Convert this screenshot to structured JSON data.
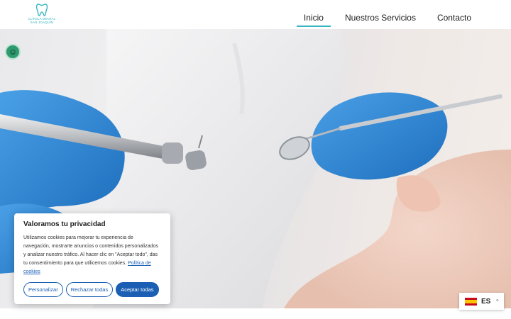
{
  "header": {
    "logo": {
      "line1": "CLÍNICA DENTAL",
      "line2": "SAN JOAQUÍN"
    },
    "nav": [
      {
        "label": "Inicio",
        "active": true
      },
      {
        "label": "Nuestros Servicios",
        "active": false
      },
      {
        "label": "Contacto",
        "active": false
      }
    ]
  },
  "accessibility": {
    "icon": "accessibility-icon"
  },
  "cookie_banner": {
    "title": "Valoramos tu privacidad",
    "text": "Utilizamos cookies para mejorar tu experiencia de navegación, mostrarte anuncios o contenidos personalizados y analizar nuestro tráfico. Al hacer clic en \"Aceptar todo\", das tu consentimiento para que utilicemos cookies.",
    "link": "Política de cookies",
    "buttons": {
      "customize": "Personalizar",
      "reject": "Rechazar todas",
      "accept": "Aceptar todas"
    }
  },
  "language": {
    "code": "ES",
    "icon": "spain-flag-icon"
  },
  "colors": {
    "accent": "#36b5c0",
    "primary_button": "#1a5fb4",
    "glove": "#2f86d4"
  }
}
